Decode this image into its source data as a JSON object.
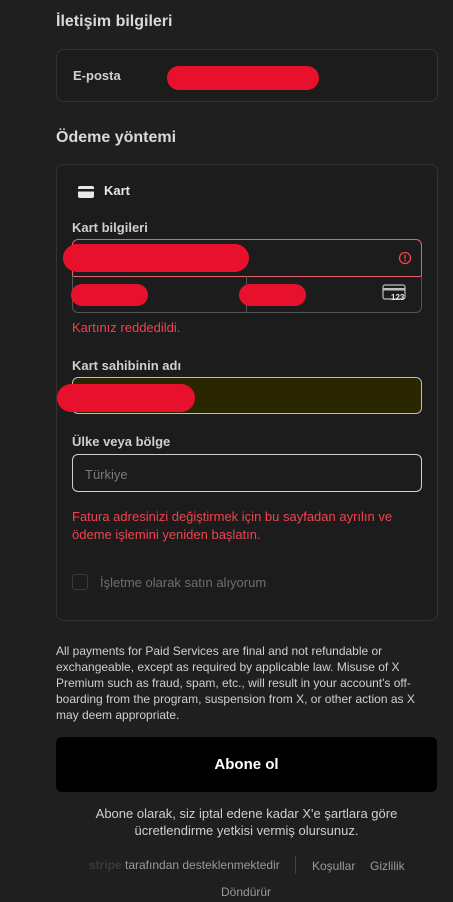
{
  "contact": {
    "title": "İletişim bilgileri",
    "email_label": "E-posta"
  },
  "payment": {
    "title": "Ödeme yöntemi",
    "method_label": "Kart",
    "card_info_label": "Kart bilgileri",
    "card_error": "Kartınız reddedildi.",
    "holder_label": "Kart sahibinin adı",
    "country_label": "Ülke veya bölge",
    "country_value": "Türkiye",
    "address_warning": "Fatura adresinizi değiştirmek için bu sayfadan ayrılın ve ödeme işlemini yeniden başlatın.",
    "business_checkbox_label": "İşletme olarak satın alıyorum",
    "cvc_icon_text": "123"
  },
  "disclaimer": "All payments for Paid Services are final and not refundable or exchangeable, except as required by applicable law. Misuse of X Premium such as fraud, spam, etc., will result in your account's off-boarding from the program, suspension from X, or other action as X may deem appropriate.",
  "subscribe_button": "Abone ol",
  "consent_text": "Abone olarak, siz iptal edene kadar X'e şartlara göre ücretlendirme yetkisi vermiş olursunuz.",
  "footer": {
    "stripe_logo": "stripe",
    "powered_by": "tarafından desteklenmektedir",
    "terms": "Koşullar",
    "privacy": "Gizlilik",
    "returns": "Döndürür"
  },
  "colors": {
    "background": "#1f1f1f",
    "error": "#f0434f",
    "redaction": "#e8112d",
    "autofill": "#2a2600"
  }
}
